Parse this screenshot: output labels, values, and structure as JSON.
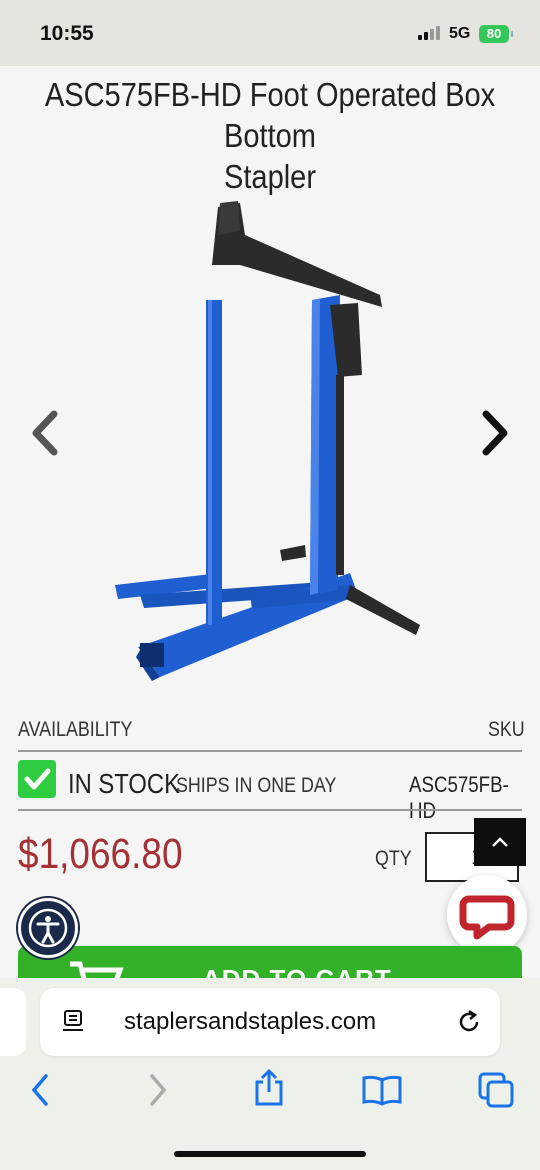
{
  "status": {
    "time": "10:55",
    "network": "5G",
    "battery": "80"
  },
  "product": {
    "title_line1": "ASC575FB-HD Foot Operated Box Bottom",
    "title_line2": "Stapler",
    "image_alt": "Foot operated box bottom stapler",
    "availability_label": "AVAILABILITY",
    "sku_label": "SKU",
    "stock_status": "IN STOCK",
    "ship_note": "SHIPS IN ONE DAY",
    "sku": "ASC575FB-HD",
    "price": "$1,066.80",
    "qty_label": "QTY",
    "qty_value": "1",
    "add_to_cart": "ADD TO CART"
  },
  "browser": {
    "url": "staplersandstaples.com"
  },
  "icons": [
    "chevron-left-icon",
    "chevron-right-icon",
    "checkmark-icon",
    "chevron-up-icon",
    "chat-icon",
    "accessibility-icon",
    "cart-icon",
    "reader-icon",
    "reload-icon",
    "back-icon",
    "forward-icon",
    "share-icon",
    "bookmarks-icon",
    "tabs-icon"
  ],
  "colors": {
    "price": "#a33035",
    "accent_green": "#33b229",
    "stock_green": "#2ecc40",
    "machine_blue": "#1f5fd1"
  }
}
